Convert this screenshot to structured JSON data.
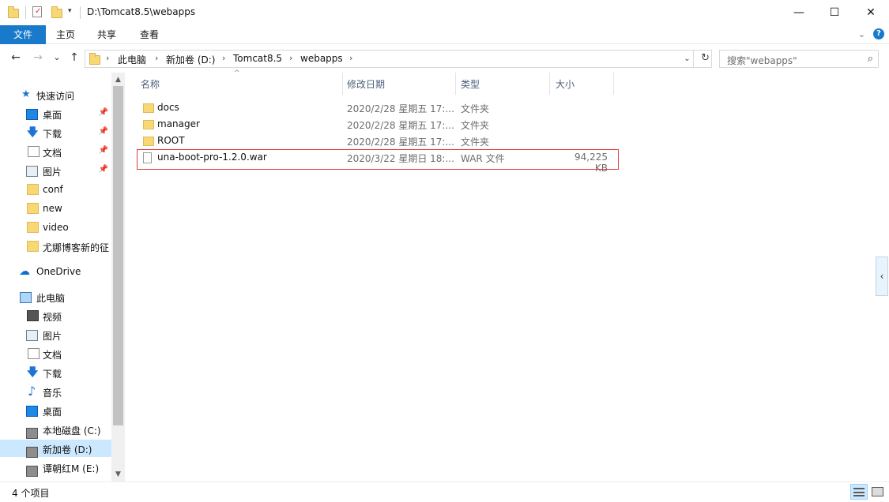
{
  "window": {
    "title": "D:\\Tomcat8.5\\webapps",
    "minimize_glyph": "—",
    "maximize_glyph": "☐",
    "close_glyph": "✕"
  },
  "ribbon": {
    "tabs": [
      "文件",
      "主页",
      "共享",
      "查看"
    ],
    "help_glyph": "?"
  },
  "nav": {
    "back_glyph": "←",
    "forward_glyph": "→",
    "recent_glyph": "⌄",
    "up_glyph": "↑",
    "breadcrumbs": [
      "此电脑",
      "新加卷 (D:)",
      "Tomcat8.5",
      "webapps"
    ],
    "search_placeholder": "搜索\"webapps\""
  },
  "sidebar": {
    "quick_access": "快速访问",
    "quick_items": [
      {
        "label": "桌面",
        "icon": "desktop-icon",
        "pinned": true
      },
      {
        "label": "下载",
        "icon": "download-icon",
        "pinned": true
      },
      {
        "label": "文档",
        "icon": "document-icon",
        "pinned": true
      },
      {
        "label": "图片",
        "icon": "picture-icon",
        "pinned": true
      },
      {
        "label": "conf",
        "icon": "folder-icon",
        "pinned": false
      },
      {
        "label": "new",
        "icon": "folder-icon",
        "pinned": false
      },
      {
        "label": "video",
        "icon": "folder-icon",
        "pinned": false
      },
      {
        "label": "尤娜博客新的征",
        "icon": "folder-icon",
        "pinned": false
      }
    ],
    "onedrive": "OneDrive",
    "this_pc": "此电脑",
    "pc_items": [
      {
        "label": "视频",
        "icon": "video-icon"
      },
      {
        "label": "图片",
        "icon": "picture-icon"
      },
      {
        "label": "文档",
        "icon": "document-icon"
      },
      {
        "label": "下载",
        "icon": "download-icon"
      },
      {
        "label": "音乐",
        "icon": "music-icon"
      },
      {
        "label": "桌面",
        "icon": "desktop-icon"
      },
      {
        "label": "本地磁盘 (C:)",
        "icon": "drive-icon"
      },
      {
        "label": "新加卷 (D:)",
        "icon": "drive-icon",
        "selected": true
      },
      {
        "label": "谭朝红M (E:)",
        "icon": "drive-icon"
      }
    ]
  },
  "columns": [
    "名称",
    "修改日期",
    "类型",
    "大小"
  ],
  "files": [
    {
      "name": "docs",
      "date": "2020/2/28 星期五 17:...",
      "type": "文件夹",
      "size": "",
      "kind": "folder"
    },
    {
      "name": "manager",
      "date": "2020/2/28 星期五 17:...",
      "type": "文件夹",
      "size": "",
      "kind": "folder"
    },
    {
      "name": "ROOT",
      "date": "2020/2/28 星期五 17:...",
      "type": "文件夹",
      "size": "",
      "kind": "folder"
    },
    {
      "name": "una-boot-pro-1.2.0.war",
      "date": "2020/3/22 星期日 18:...",
      "type": "WAR 文件",
      "size": "94,225 KB",
      "kind": "file",
      "highlighted": true
    }
  ],
  "status": {
    "item_count": "4 个项目"
  },
  "colors": {
    "accent": "#1979ca",
    "selection": "#cce8ff",
    "highlight_border": "#e23b3b"
  }
}
